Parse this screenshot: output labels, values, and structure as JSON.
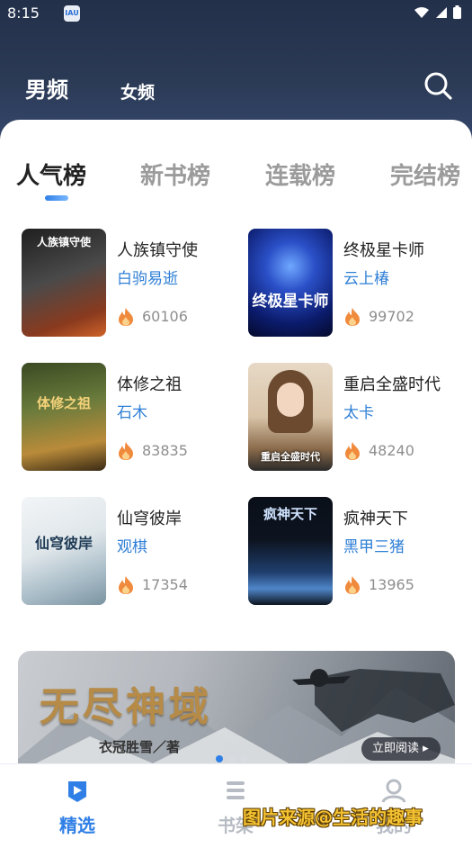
{
  "status_bar": {
    "time": "8:15",
    "notif_icon": "app-notification-icon",
    "notif_label": "IAU"
  },
  "header": {
    "tabs": [
      "男频",
      "女频"
    ],
    "active_tab": "男频",
    "search_icon": "search-icon"
  },
  "rank_tabs": {
    "items": [
      "人气榜",
      "新书榜",
      "连载榜",
      "完结榜"
    ],
    "active": "人气榜",
    "accent": "#2f7fe6"
  },
  "books": [
    {
      "title": "人族镇守使",
      "author": "白驹易逝",
      "heat": "60106",
      "cover_text": "人族镇守使",
      "cover_colors": [
        "#2b2b2b",
        "#8a3a1e"
      ]
    },
    {
      "title": "终极星卡师",
      "author": "云上椿",
      "heat": "99702",
      "cover_text": "终极星卡师",
      "cover_colors": [
        "#0b1b6b",
        "#3560d8"
      ]
    },
    {
      "title": "体修之祖",
      "author": "石木",
      "heat": "83835",
      "cover_text": "体修之祖",
      "cover_colors": [
        "#5a6b34",
        "#b98b3a"
      ]
    },
    {
      "title": "重启全盛时代",
      "author": "太卡",
      "heat": "48240",
      "cover_text": "重启全盛时代",
      "cover_colors": [
        "#d8c3a8",
        "#6b4a30"
      ]
    },
    {
      "title": "仙穹彼岸",
      "author": "观棋",
      "heat": "17354",
      "cover_text": "仙穹彼岸",
      "cover_colors": [
        "#dfe6ea",
        "#8fa6b4"
      ]
    },
    {
      "title": "疯神天下",
      "author": "黑甲三猪",
      "heat": "13965",
      "cover_text": "疯神天下",
      "cover_colors": [
        "#0d1420",
        "#2b5d9a"
      ]
    }
  ],
  "banner": {
    "title": "无尽神域",
    "author": "衣冠胜雪／著",
    "button": "立即阅读 ▸"
  },
  "bottom_nav": {
    "items": [
      {
        "label": "精选",
        "icon": "featured-icon",
        "active": true
      },
      {
        "label": "书架",
        "icon": "bookshelf-icon",
        "active": false
      },
      {
        "label": "我的",
        "icon": "profile-icon",
        "active": false
      }
    ],
    "active_color": "#2f7fe6",
    "inactive_color": "#b7bcc4"
  },
  "watermark": "图片来源@生活的趣事"
}
